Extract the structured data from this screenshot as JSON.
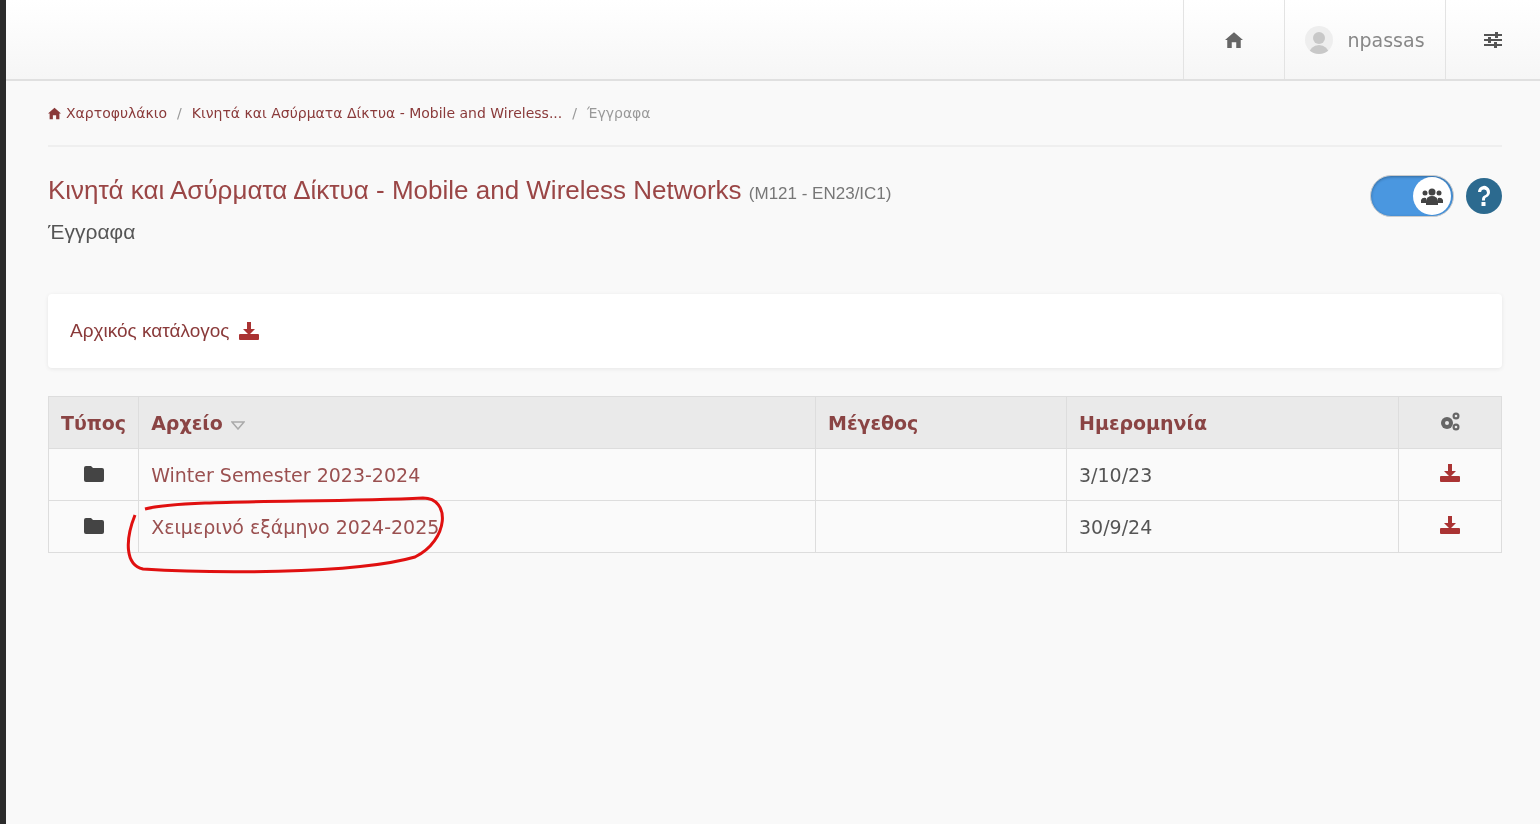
{
  "navbar": {
    "user": "npassas"
  },
  "breadcrumb": [
    {
      "label": "Χαρτοφυλάκιο",
      "kind": "home",
      "active": false
    },
    {
      "separator": "/",
      "label": "Κινητά και Ασύρματα Δίκτυα - Mobile and Wireless...",
      "kind": "link",
      "active": false
    },
    {
      "separator": "/",
      "label": "Έγγραφα",
      "kind": "link",
      "active": true
    }
  ],
  "course": {
    "title": "Κινητά και Ασύρματα Δίκτυα - Mobile and Wireless Networks",
    "code": "(M121 - EN23/IC1)",
    "subtitle": "Έγγραφα",
    "view_toggle": {
      "on": true
    }
  },
  "directory": {
    "label": "Αρχικός κατάλογος"
  },
  "table": {
    "columns": [
      {
        "label": "Τύπος",
        "sorted": false
      },
      {
        "label": "Αρχείο",
        "sorted": true
      },
      {
        "label": "Μέγεθος",
        "sorted": false
      },
      {
        "label": "Ημερομηνία",
        "sorted": false
      }
    ],
    "rows": [
      {
        "name": "Winter Semester 2023-2024",
        "date": "3/10/23",
        "circled": false
      },
      {
        "name": "Χειμερινό εξάμηνο 2024-2025",
        "date": "30/9/24",
        "circled": true
      }
    ]
  }
}
